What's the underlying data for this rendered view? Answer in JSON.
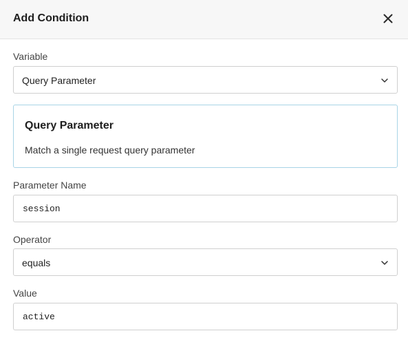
{
  "dialog": {
    "title": "Add Condition"
  },
  "variable": {
    "label": "Variable",
    "selected": "Query Parameter"
  },
  "info": {
    "title": "Query Parameter",
    "description": "Match a single request query parameter"
  },
  "parameter_name": {
    "label": "Parameter Name",
    "value": "session"
  },
  "operator": {
    "label": "Operator",
    "selected": "equals"
  },
  "value_field": {
    "label": "Value",
    "value": "active"
  },
  "icons": {
    "close": "close-icon",
    "dropdown": "chevron-down-icon"
  },
  "colors": {
    "header_bg": "#f7f7f7",
    "info_border": "#a8d4e6",
    "field_border": "#cfcfcf"
  }
}
